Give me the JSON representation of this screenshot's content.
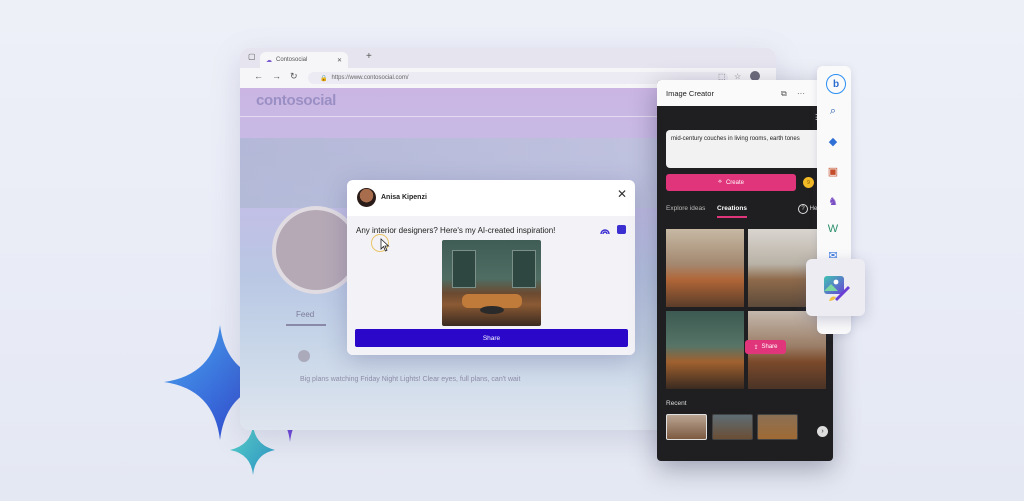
{
  "browser": {
    "tab_title": "Contosocial",
    "url": "https://www.contosocial.com/",
    "site_logo": "contosocial",
    "feed_tab": "Feed",
    "ghost_post_text": "Big plans watching Friday Night Lights! Clear eyes, full plans, can't wait"
  },
  "share_dialog": {
    "user_name": "Anisa Kipenzi",
    "message": "Any interior designers? Here's my AI-created inspiration!",
    "share_label": "Share",
    "close_icon": "close-icon"
  },
  "image_creator": {
    "title": "Image Creator",
    "prompt": "mid-century couches in living rooms, earth tones",
    "create_label": "Create",
    "coin_value": "9",
    "tabs": [
      "Explore ideas",
      "Creations"
    ],
    "active_tab": "Creations",
    "help_label": "He",
    "share_pill": "Share",
    "recent_label": "Recent"
  },
  "colors": {
    "accent_pink": "#e0357a",
    "share_blue": "#2a07c9",
    "panel_bg": "#1f1f21"
  },
  "sidebar": {
    "icons": [
      "bing-icon",
      "search-icon",
      "tag-icon",
      "briefcase-icon",
      "chess-icon",
      "office-icon",
      "outlook-icon",
      "image-creator-icon"
    ]
  }
}
